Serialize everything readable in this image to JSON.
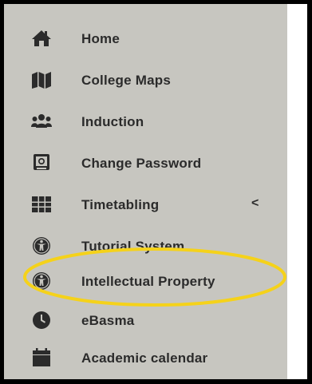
{
  "sidebar": {
    "items": [
      {
        "label": "Home",
        "icon": "home-icon"
      },
      {
        "label": "College Maps",
        "icon": "map-icon"
      },
      {
        "label": "Induction",
        "icon": "users-icon"
      },
      {
        "label": "Change Password",
        "icon": "id-card-icon"
      },
      {
        "label": "Timetabling",
        "icon": "grid-icon",
        "chevron": "<"
      },
      {
        "label": "Tutorial System",
        "icon": "universal-access-icon"
      },
      {
        "label": "Intellectual Property",
        "icon": "universal-access-icon"
      },
      {
        "label": "eBasma",
        "icon": "clock-icon"
      },
      {
        "label": "Academic calendar",
        "icon": "calendar-icon"
      }
    ]
  },
  "colors": {
    "sidebar_bg": "#c7c6c0",
    "text": "#2b2b2b",
    "highlight": "#f5d21a"
  }
}
